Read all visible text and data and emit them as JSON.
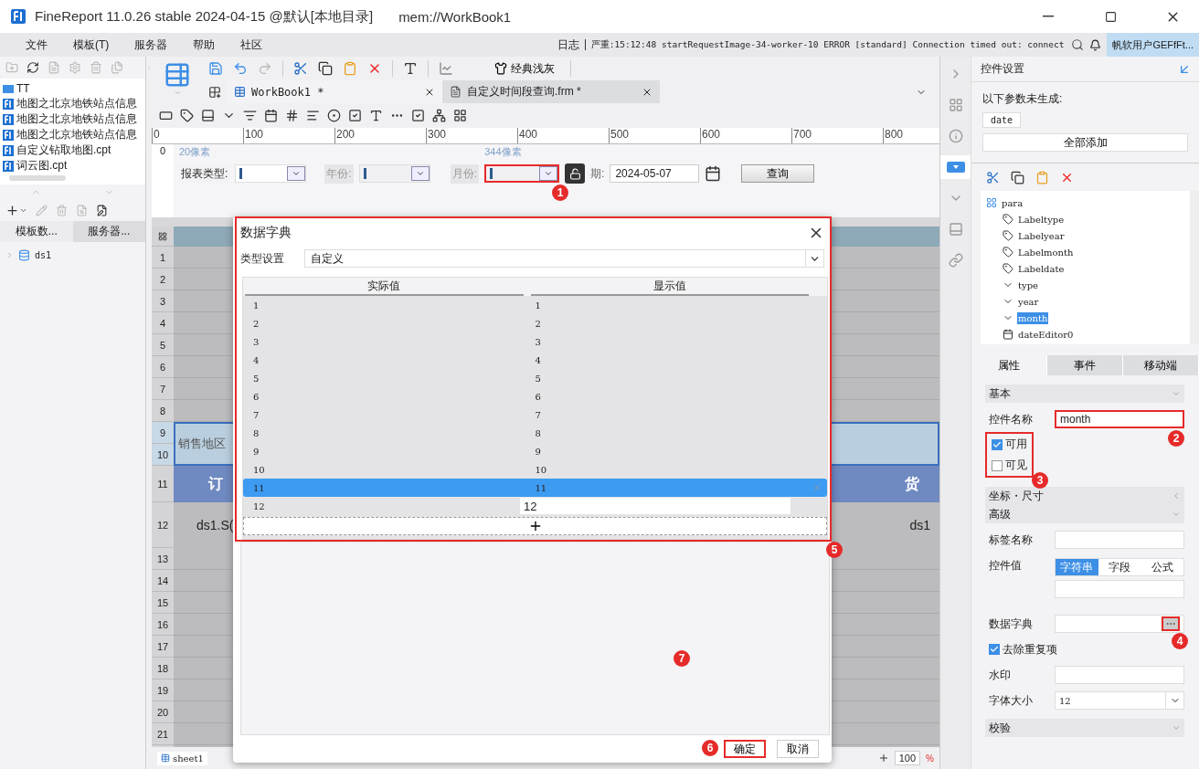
{
  "window": {
    "title": "FineReport 11.0.26 stable 2024-04-15 @默认[本地目录]",
    "path": "mem://WorkBook1"
  },
  "menu": [
    {
      "label": "文件"
    },
    {
      "label": "模板(T)"
    },
    {
      "label": "服务器"
    },
    {
      "label": "帮助"
    },
    {
      "label": "社区"
    }
  ],
  "log": {
    "label": "日志",
    "message": "严重:15:12:48 startRequestImage-34-worker-10 ERROR [standard] Connection timed out: connect"
  },
  "user": "帆软用户GEFfFt...",
  "left_panel": {
    "files": [
      {
        "name": "TT",
        "kind": "folder"
      },
      {
        "name": "地图之北京地铁站点信息",
        "kind": "report"
      },
      {
        "name": "地图之北京地铁站点信息",
        "kind": "report"
      },
      {
        "name": "地图之北京地铁站点信息",
        "kind": "report"
      },
      {
        "name": "自定义钻取地图.cpt",
        "kind": "report"
      },
      {
        "name": "词云图.cpt",
        "kind": "report"
      }
    ],
    "tabs": [
      {
        "label": "模板数...",
        "selected": true
      },
      {
        "label": "服务器...",
        "selected": false
      }
    ],
    "datasets": [
      {
        "name": "ds1"
      }
    ]
  },
  "toolbar": {
    "theme_button": "经典浅灰"
  },
  "doc_tabs": [
    {
      "label": "WorkBook1 *",
      "selected": true
    },
    {
      "label": "自定义时间段查询.frm *",
      "selected": false
    }
  ],
  "ruler": [
    "0",
    "100",
    "200",
    "300",
    "400",
    "500",
    "600",
    "700",
    "800"
  ],
  "vertical_ruler": "0",
  "param_form": {
    "hint_top": "20像素",
    "hint_width": "344像素",
    "fields": [
      {
        "label": "报表类型:",
        "kind": "combo",
        "greyed": false,
        "highlighted": false
      },
      {
        "label": "年份:",
        "kind": "combo",
        "greyed": true,
        "highlighted": false
      },
      {
        "label": "月份:",
        "kind": "combo",
        "greyed": true,
        "highlighted": true,
        "marker": "1"
      },
      {
        "label": "期:",
        "kind": "date",
        "value": "2024-05-07"
      }
    ],
    "query_button": "查询"
  },
  "sheet": {
    "row_numbers": [
      "1",
      "2",
      "3",
      "4",
      "5",
      "6",
      "7",
      "8",
      "9",
      "10",
      "11",
      "12",
      "13",
      "14",
      "15",
      "16",
      "17",
      "18",
      "19",
      "20",
      "21"
    ],
    "region_label": "销售地区",
    "header_cells": [
      "订",
      "货"
    ],
    "data_cells": [
      "ds1.S(",
      "ds1"
    ],
    "sheet_tabs": [
      {
        "label": "sheet1",
        "selected": true
      }
    ],
    "zoom": "100",
    "zoom_unit": "%"
  },
  "dialog": {
    "title": "数据字典",
    "type_label": "类型设置",
    "type_value": "自定义",
    "columns": [
      "实际值",
      "显示值"
    ],
    "rows": [
      {
        "actual": "1",
        "display": "1",
        "selected": false,
        "editing": false
      },
      {
        "actual": "2",
        "display": "2",
        "selected": false,
        "editing": false
      },
      {
        "actual": "3",
        "display": "3",
        "selected": false,
        "editing": false
      },
      {
        "actual": "4",
        "display": "4",
        "selected": false,
        "editing": false
      },
      {
        "actual": "5",
        "display": "5",
        "selected": false,
        "editing": false
      },
      {
        "actual": "6",
        "display": "6",
        "selected": false,
        "editing": false
      },
      {
        "actual": "7",
        "display": "7",
        "selected": false,
        "editing": false
      },
      {
        "actual": "8",
        "display": "8",
        "selected": false,
        "editing": false
      },
      {
        "actual": "9",
        "display": "9",
        "selected": false,
        "editing": false
      },
      {
        "actual": "10",
        "display": "10",
        "selected": false,
        "editing": false
      },
      {
        "actual": "11",
        "display": "11",
        "selected": true,
        "editing": false
      },
      {
        "actual": "12",
        "display": "12",
        "selected": false,
        "editing": true
      }
    ],
    "table_marker": "5",
    "empty_marker": "7",
    "buttons": [
      {
        "label": "确定",
        "highlighted": true,
        "marker": "6"
      },
      {
        "label": "取消",
        "highlighted": false
      }
    ]
  },
  "side_tools": [
    {
      "selected": false
    },
    {
      "selected": false
    },
    {
      "selected": false
    },
    {
      "selected": true
    },
    {
      "selected": false
    },
    {
      "selected": false
    }
  ],
  "right_panel": {
    "title": "控件设置",
    "missing_label": "以下参数未生成:",
    "missing_params": [
      "date"
    ],
    "add_all": "全部添加",
    "tree": {
      "name": "para",
      "children": [
        {
          "name": "Labeltype",
          "kind": "label",
          "selected": false
        },
        {
          "name": "Labelyear",
          "kind": "label",
          "selected": false
        },
        {
          "name": "Labelmonth",
          "kind": "label",
          "selected": false
        },
        {
          "name": "Labeldate",
          "kind": "label",
          "selected": false
        },
        {
          "name": "type",
          "kind": "combo",
          "selected": false
        },
        {
          "name": "year",
          "kind": "combo",
          "selected": false
        },
        {
          "name": "month",
          "kind": "combo",
          "selected": true
        },
        {
          "name": "dateEditor0",
          "kind": "date",
          "selected": false
        }
      ]
    },
    "tabs": [
      {
        "label": "属性",
        "selected": true
      },
      {
        "label": "事件",
        "selected": false
      },
      {
        "label": "移动端",
        "selected": false
      }
    ],
    "properties": [
      {
        "kind": "section",
        "label": "基本",
        "expanded": true
      },
      {
        "kind": "text",
        "label": "控件名称",
        "value": "month",
        "highlighted": true,
        "marker": "2"
      },
      {
        "kind": "checks",
        "highlighted": true,
        "marker": "3",
        "items": [
          {
            "label": "可用",
            "checked": true
          },
          {
            "label": "可见",
            "checked": false
          }
        ]
      },
      {
        "kind": "section",
        "label": "坐标・尺寸",
        "expanded": false
      },
      {
        "kind": "section",
        "label": "高级",
        "expanded": true
      },
      {
        "kind": "text",
        "label": "标签名称",
        "highlighted": false
      },
      {
        "kind": "segmented",
        "label": "控件值",
        "options": [
          {
            "label": "字符串",
            "selected": true
          },
          {
            "label": "字段",
            "selected": false
          },
          {
            "label": "公式",
            "selected": false
          }
        ]
      },
      {
        "kind": "dict",
        "label": "数据字典",
        "highlighted": true,
        "marker": "4"
      },
      {
        "kind": "check",
        "label": "去除重复项",
        "checked": true
      },
      {
        "kind": "text",
        "label": "水印",
        "highlighted": false
      },
      {
        "kind": "select",
        "label": "字体大小",
        "value": "12"
      },
      {
        "kind": "section",
        "label": "校验",
        "expanded": true
      }
    ]
  }
}
